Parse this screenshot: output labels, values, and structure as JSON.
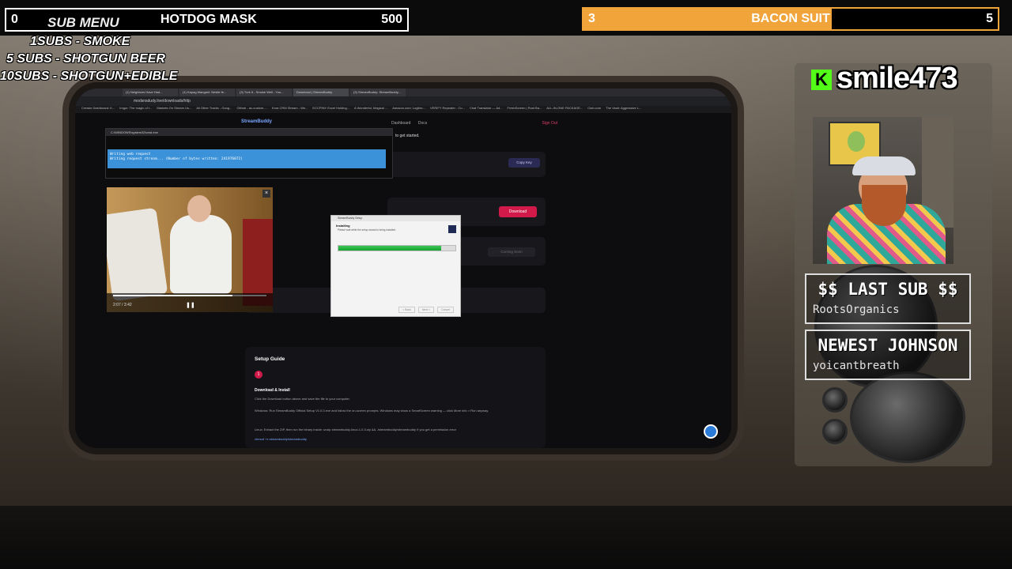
{
  "top_left_goal": {
    "current": "0",
    "title": "HOTDOG MASK",
    "target": "500"
  },
  "top_right_goal": {
    "current": "3",
    "title": "BACON SUIT",
    "target": "5",
    "progress": 0.6,
    "color": "#f0a43a"
  },
  "sub_menu": {
    "label": "SUB MENU",
    "items": [
      "1SUBS   - SMOKE",
      "5 SUBS  - SHOTGUN BEER",
      "10SUBS - SHOTGUN+EDIBLE"
    ]
  },
  "channel": {
    "name": "smile473",
    "logo_letter": "K",
    "logo_color": "#53fc18"
  },
  "last_sub": {
    "title": "$$ LAST SUB $$",
    "name": "RootsOrganics"
  },
  "newest": {
    "title": "NEWEST JOHNSON",
    "name": "yoicantbreath"
  },
  "screen": {
    "tabs": [
      "(1) Neighbors Have Had...",
      "(1) Kapag Mangani: Nestle fe...",
      "(3) Turk It - Smoke Well - You...",
      "Download | StreamBuddy",
      "(3) StreamBuddy: StreamBuddy..."
    ],
    "url": "modsnsdudy.live/downloads/http",
    "bookmarks": [
      "Creator Dashboard: K...",
      "Imgur: The magic of t...",
      "Markets On Stream Us...",
      "All Other Tracks - Goog...",
      "Github - ac-custom-...",
      "Kora CRM Stream - We...",
      "ECCPINY Excel Holding...",
      "A Wonderful, Magical ...",
      "Amazon.com: Logitec...",
      "VERIFY Repeater - Co...",
      "Chat Translator — Ad...",
      "FreshScreen | Rust Ba...",
      "ALL-IN-ONE PACKAGE...",
      "Club.com",
      "The Vault: Aggressive L..."
    ],
    "site_logo": "StreamBuddy",
    "nav": [
      "Dashboard",
      "Docs"
    ],
    "sign_out": "Sign Out",
    "get_started": "to get started.",
    "copy_key": "Copy Key",
    "download": "Download",
    "coming_soon": "Coming Soon",
    "cmd_title": "C:\\WINDOWS\\system32\\cmd.exe",
    "cmd_line1": "Writing web request",
    "cmd_line2": "   Writing request stream... (Number of bytes written: 241976072)",
    "video_time": "2:07 / 3:42",
    "installer_title": "StreamBuddy Setup",
    "installer_heading": "Installing",
    "installer_sub": "Please wait while the setup wizard is being installed.",
    "installer_progress": 0.88,
    "installer_buttons": [
      "< Back",
      "Next >",
      "Cancel"
    ],
    "setup_title": "Setup Guide",
    "step_number": "1",
    "step_title": "Download & Install",
    "step_lines": [
      "Click the Download button above and save the file to your computer.",
      "Windows: Run StreamBuddy Official Setup V1.0.3.exe and follow the on-screen prompts. Windows may show a SmartScreen warning — click More info > Run anyway.",
      "Linux: Extract the ZIP, then run the binary inside:  unzip streambuddy-linux-1.0.3.zip && ./streambuddy/streambuddy  If you get a permission error",
      "chmod +x streambuddy/streambuddy"
    ]
  }
}
